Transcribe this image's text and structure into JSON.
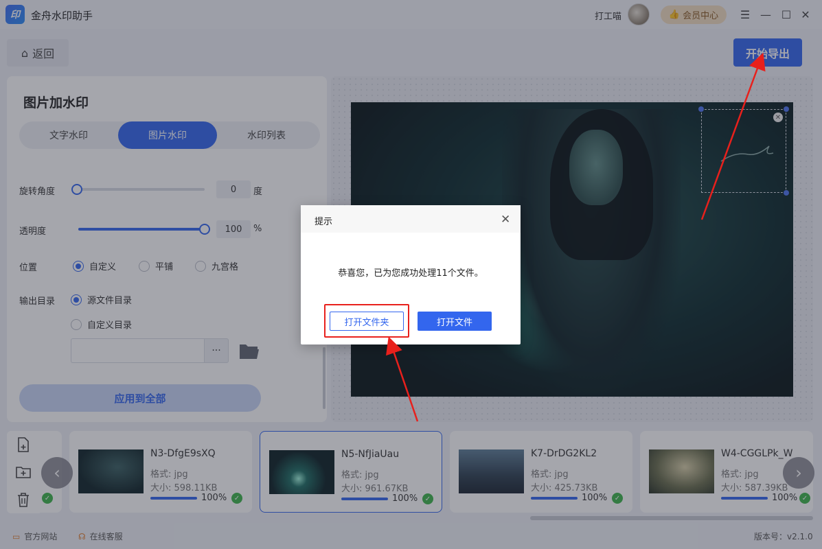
{
  "app": {
    "logo_text": "印",
    "title": "金舟水印助手"
  },
  "user": {
    "name": "打工喵",
    "vip_label": "会员中心"
  },
  "toolbar": {
    "back_label": "返回",
    "export_label": "开始导出"
  },
  "panel": {
    "title": "图片加水印",
    "tabs": [
      "文字水印",
      "图片水印",
      "水印列表"
    ],
    "active_tab": 1,
    "rotation": {
      "label": "旋转角度",
      "value": "0",
      "unit": "度"
    },
    "opacity": {
      "label": "透明度",
      "value": "100",
      "unit": "%"
    },
    "position": {
      "label": "位置",
      "options": [
        "自定义",
        "平铺",
        "九宫格"
      ],
      "selected": 0
    },
    "output": {
      "label": "输出目录",
      "options": [
        "源文件目录",
        "自定义目录"
      ],
      "selected": 0,
      "path_value": "",
      "more_label": "···"
    },
    "apply_label": "应用到全部"
  },
  "dialog": {
    "title": "提示",
    "message": "恭喜您，已为您成功处理11个文件。",
    "open_folder_label": "打开文件夹",
    "open_file_label": "打开文件"
  },
  "files": [
    {
      "name": "N3-DfgE9sXQ",
      "format": "格式: jpg",
      "size": "大小: 598.11KB",
      "progress": "100%",
      "active": false
    },
    {
      "name": "N5-NfJiaUau",
      "format": "格式: jpg",
      "size": "大小: 961.67KB",
      "progress": "100%",
      "active": true
    },
    {
      "name": "K7-DrDG2KL2",
      "format": "格式: jpg",
      "size": "大小: 425.73KB",
      "progress": "100%",
      "active": false
    },
    {
      "name": "W4-CGGLPk_W",
      "format": "格式: jpg",
      "size": "大小: 587.39KB",
      "progress": "100%",
      "active": false
    }
  ],
  "footer": {
    "website_label": "官方网站",
    "support_label": "在线客服",
    "version": "版本号：v2.1.0"
  },
  "colors": {
    "accent": "#3366ee",
    "highlight": "#e8201c",
    "success": "#3db54a"
  }
}
